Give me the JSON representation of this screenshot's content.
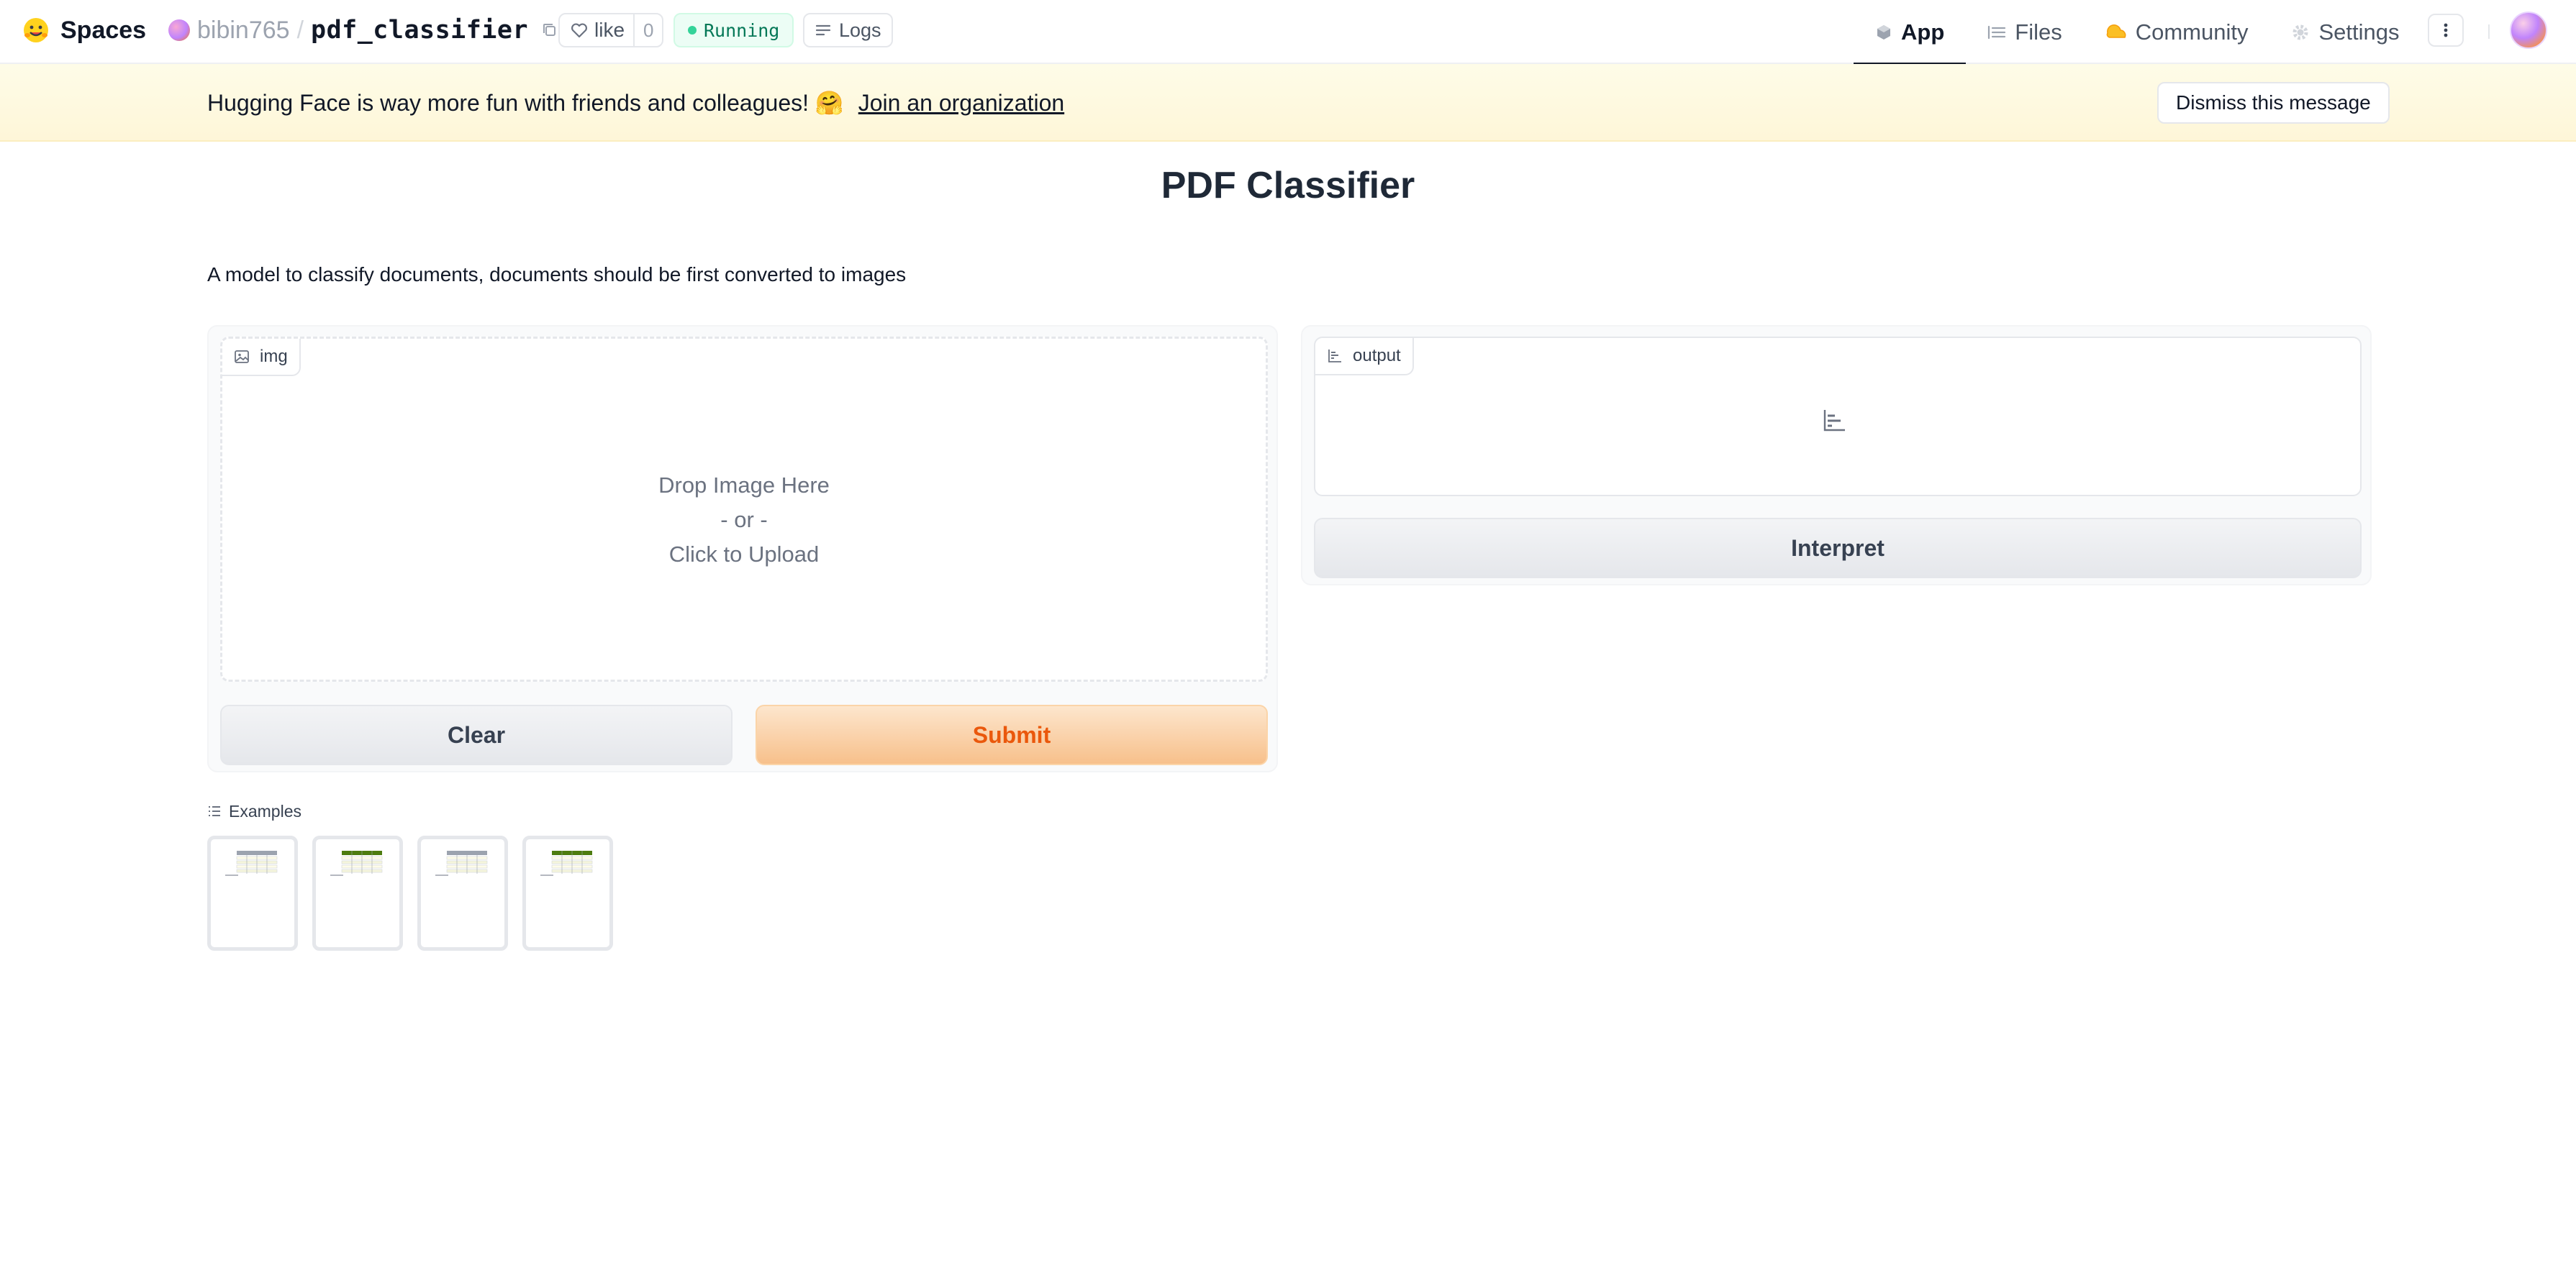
{
  "header": {
    "brand": "Spaces",
    "owner": "bibin765",
    "separator": "/",
    "repo": "pdf_classifier",
    "like_label": "like",
    "like_count": "0",
    "status": "Running",
    "logs_label": "Logs",
    "nav": [
      {
        "label": "App",
        "active": true
      },
      {
        "label": "Files"
      },
      {
        "label": "Community"
      },
      {
        "label": "Settings"
      }
    ]
  },
  "banner": {
    "text": "Hugging Face is way more fun with friends and colleagues! 🤗",
    "link": "Join an organization",
    "dismiss": "Dismiss this message"
  },
  "app": {
    "title": "PDF Classifier",
    "description": "A model to classify documents, documents should be first converted to images",
    "input": {
      "label": "img",
      "drop_line1": "Drop Image Here",
      "drop_line2": "- or -",
      "drop_line3": "Click to Upload"
    },
    "clear_label": "Clear",
    "submit_label": "Submit",
    "output": {
      "label": "output"
    },
    "interpret_label": "Interpret",
    "examples_label": "Examples",
    "examples": [
      {
        "header_color": "#9ca3af"
      },
      {
        "header_color": "#4d7c0f"
      },
      {
        "header_color": "#9ca3af"
      },
      {
        "header_color": "#4d7c0f"
      }
    ]
  },
  "colors": {
    "accent": "#ea580c",
    "status_green": "#34d399",
    "banner_bg": "#fef9e0"
  }
}
